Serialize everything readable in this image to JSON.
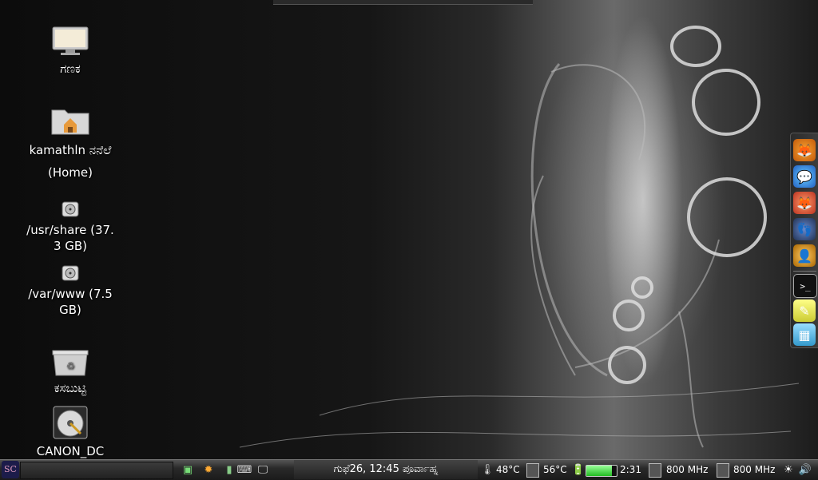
{
  "desktop": {
    "icons": [
      {
        "id": "computer",
        "label": "ಗಣಕ",
        "icon": "monitor-icon"
      },
      {
        "id": "home",
        "label": "kamathln ನನೆಲೆ\n(Home)",
        "icon": "home-folder-icon"
      },
      {
        "id": "usr-share",
        "label": "/usr/share (37.\n3 GB)",
        "icon": "hard-drive-icon"
      },
      {
        "id": "var-www",
        "label": "/var/www (7.5\nGB)",
        "icon": "hard-drive-icon"
      },
      {
        "id": "trash",
        "label": "ಕಸಬುಟ್ಟಿ",
        "icon": "trash-icon"
      },
      {
        "id": "canon",
        "label": "CANON_DC",
        "icon": "removable-disk-icon"
      }
    ]
  },
  "dock": {
    "items": [
      "gimp-icon",
      "chat-icon",
      "firefox-icon",
      "feet-icon",
      "user-icon",
      "terminal-icon",
      "notes-icon",
      "image-viewer-icon"
    ]
  },
  "panel": {
    "menu_label": "SC",
    "clock": "ಗುಫೆ26, 12:45 ಪೂರ್ವಾಹ್ನ",
    "cpu_temp": "48°C",
    "gpu_temp": "56°C",
    "battery_time": "2:31",
    "battery_level": 0.85,
    "cpu_freq_1": "800 MHz",
    "cpu_freq_2": "800 MHz"
  },
  "colors": {
    "panel": "#2a2a2a",
    "battery": "#33bb33",
    "menu": "#1c1c4a"
  }
}
